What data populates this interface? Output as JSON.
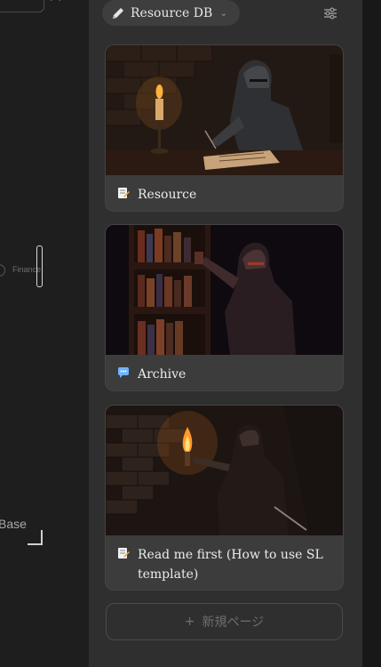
{
  "canvas": {
    "finance_label": "Finance",
    "base_label": "Base"
  },
  "database": {
    "name": "Resource DB",
    "icons": {
      "tab": "pencil-icon",
      "dropdown": "chevron-down-icon",
      "filter": "sliders-icon"
    }
  },
  "cards": [
    {
      "title": "Resource",
      "icon": "memo-icon",
      "art": "knight writing by candlelight"
    },
    {
      "title": "Archive",
      "icon": "speech-bubble-icon",
      "art": "knight pulling book from shelf"
    },
    {
      "title": "Read me first (How to use  SL template)",
      "icon": "memo-icon",
      "art": "knight holding torch in corridor"
    }
  ],
  "new_page": {
    "label": "新規ページ",
    "icon": "plus-icon"
  },
  "colors": {
    "panel": "#2f2f2f",
    "card": "#3c3c3c",
    "text": "#ececec",
    "muted": "#6e6e6e",
    "memo_accent": "#e0a43a",
    "bubble_accent": "#6fb4ff"
  }
}
